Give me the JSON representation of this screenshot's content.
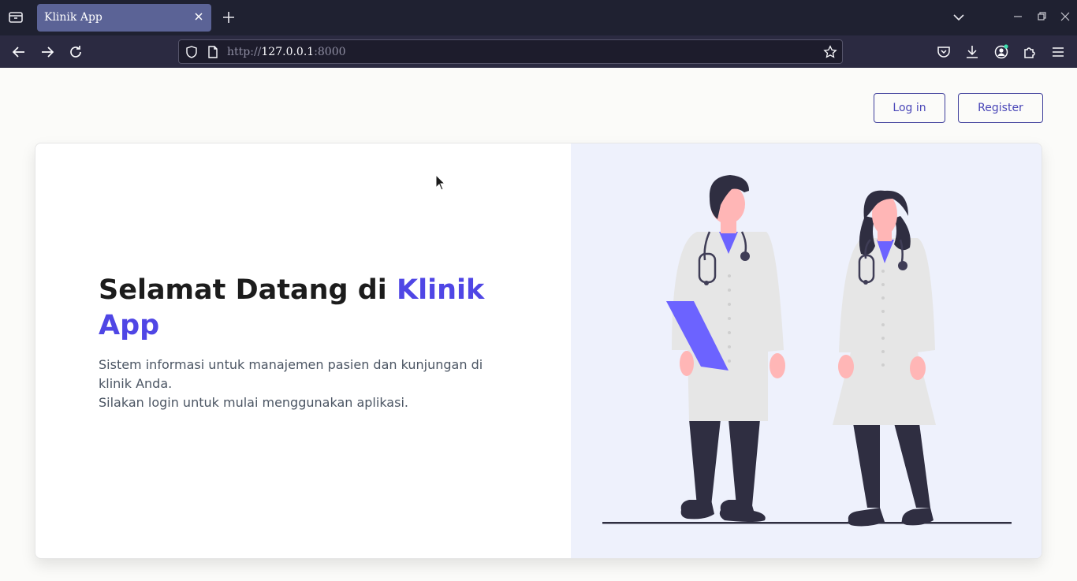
{
  "browser": {
    "tab_title": "Klinik App",
    "url_scheme": "http://",
    "url_host": "127.0.0.1",
    "url_port": ":8000"
  },
  "header": {
    "login_label": "Log in",
    "register_label": "Register"
  },
  "hero": {
    "title_main": "Selamat Datang di ",
    "title_accent": "Klinik App",
    "description_line1": "Sistem informasi untuk manajemen pasien dan kunjungan di klinik Anda.",
    "description_line2": "Silakan login untuk mulai menggunakan aplikasi."
  },
  "colors": {
    "accent": "#4f46e5",
    "illustration_bg": "#eef1fc",
    "tab_active": "#5b6396"
  },
  "icons": {
    "illustration": "two-doctors-illustration"
  }
}
